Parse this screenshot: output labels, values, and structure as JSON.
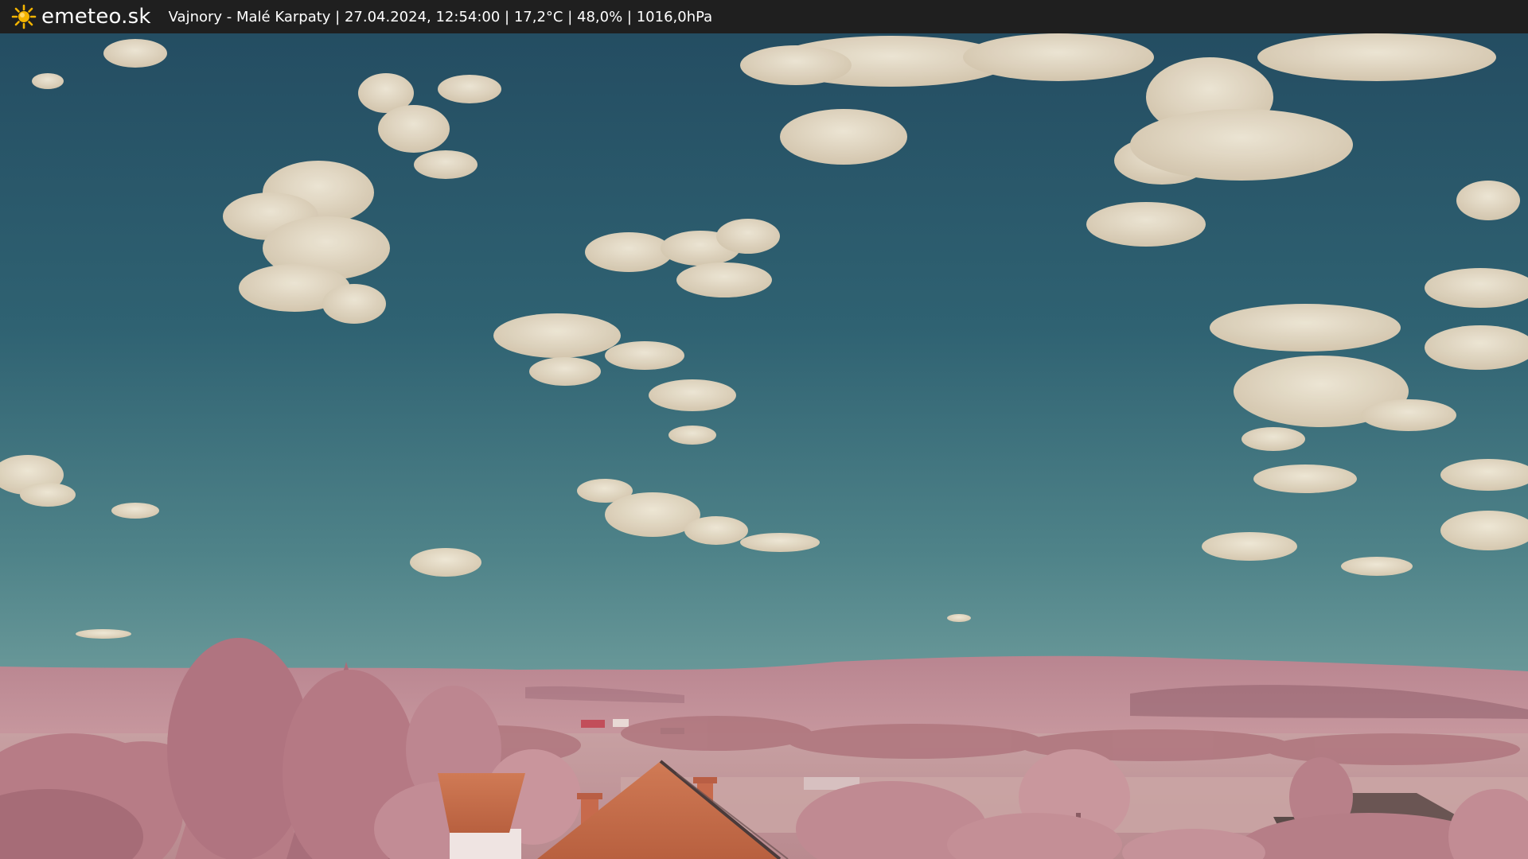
{
  "header": {
    "brand": "emeteo.sk",
    "logo_icon": "sun-icon",
    "location": "Vajnory - Malé Karpaty",
    "separator": " | ",
    "datetime": "27.04.2024, 12:54:00",
    "temperature": "17,2°C",
    "humidity": "48,0%",
    "pressure": "1016,0hPa"
  },
  "colors": {
    "bar_background": "#1f1f1f",
    "sun": "#f4b400",
    "sky_top": "#254f63",
    "sky_horizon": "#5d8f95",
    "clouds": "#efe3cf",
    "foliage": "#c08a8f",
    "roof": "#c9714e"
  }
}
